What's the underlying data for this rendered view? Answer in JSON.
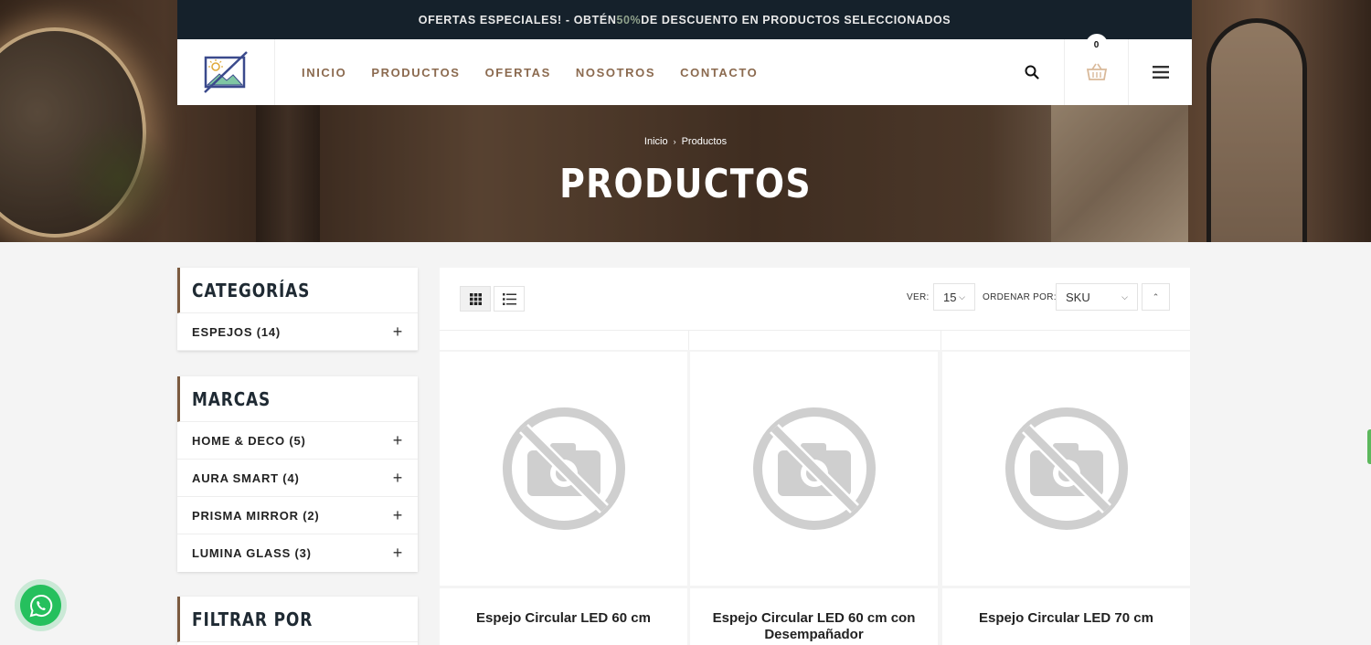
{
  "promo": {
    "text_before": "OFERTAS ESPECIALES! - OBTÉN ",
    "highlight": "50%",
    "text_after": " DE DESCUENTO EN PRODUCTOS SELECCIONADOS"
  },
  "nav": {
    "items": [
      "INICIO",
      "PRODUCTOS",
      "OFERTAS",
      "NOSOTROS",
      "CONTACTO"
    ]
  },
  "header": {
    "cart_count": "0"
  },
  "breadcrumb": {
    "home": "Inicio",
    "current": "Productos"
  },
  "page_title": "PRODUCTOS",
  "sidebar": {
    "categories": {
      "title": "CATEGORÍAS",
      "items": [
        "ESPEJOS (14)"
      ]
    },
    "brands": {
      "title": "MARCAS",
      "items": [
        "HOME & DECO (5)",
        "AURA SMART (4)",
        "PRISMA MIRROR (2)",
        "LUMINA GLASS (3)"
      ]
    },
    "filter": {
      "title": "FILTRAR POR"
    }
  },
  "toolbar": {
    "ver_label": "VER:",
    "ver_value": "15",
    "order_label": "ORDENAR POR:",
    "order_value": "SKU"
  },
  "products": [
    {
      "name": "Espejo Circular LED 60 cm"
    },
    {
      "name": "Espejo Circular LED 60 cm con Desempañador"
    },
    {
      "name": "Espejo Circular LED 70 cm"
    }
  ],
  "colors": {
    "promo_bg": "#15212b",
    "nav_text": "#8b6a4f",
    "accent": "#7b5a3f",
    "whatsapp": "#25c05d"
  }
}
